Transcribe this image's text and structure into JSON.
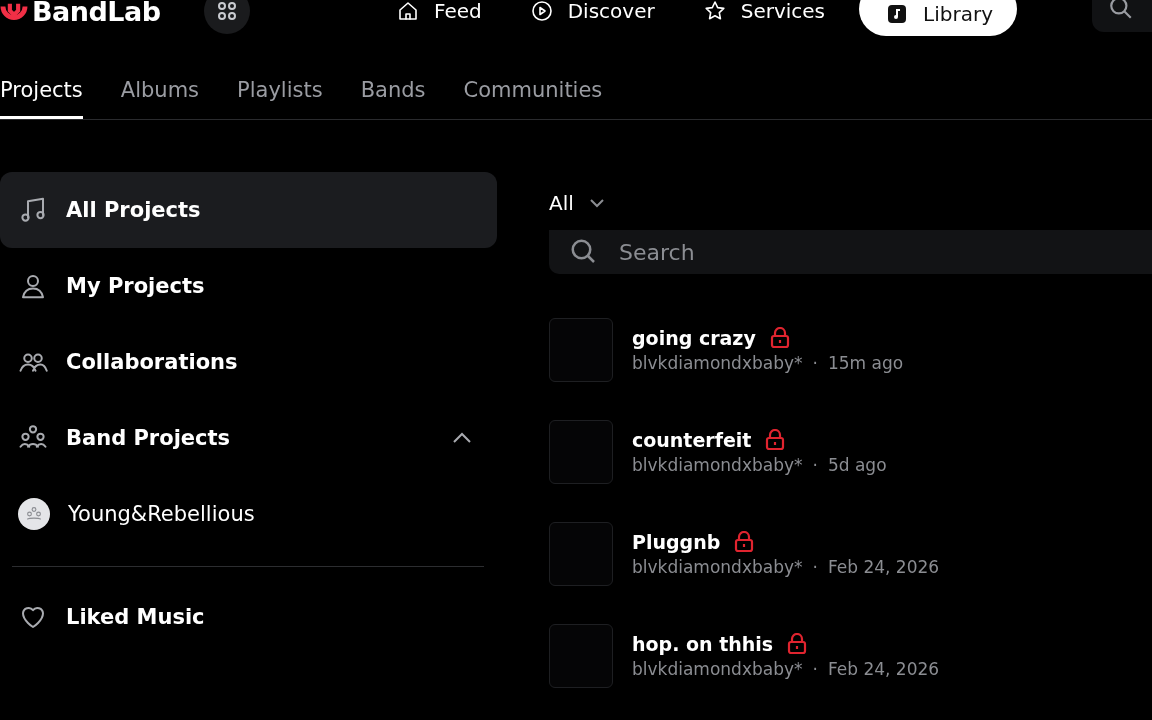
{
  "header": {
    "logo": "BandLab",
    "nav": [
      {
        "label": "Feed",
        "selected": false
      },
      {
        "label": "Discover",
        "selected": false
      },
      {
        "label": "Services",
        "selected": false
      },
      {
        "label": "Library",
        "selected": true
      }
    ]
  },
  "tabs": [
    {
      "label": "Projects",
      "selected": true
    },
    {
      "label": "Albums",
      "selected": false
    },
    {
      "label": "Playlists",
      "selected": false
    },
    {
      "label": "Bands",
      "selected": false
    },
    {
      "label": "Communities",
      "selected": false
    }
  ],
  "sidebar": {
    "items": [
      {
        "label": "All Projects",
        "selected": true
      },
      {
        "label": "My Projects",
        "selected": false
      },
      {
        "label": "Collaborations",
        "selected": false
      },
      {
        "label": "Band Projects",
        "selected": false,
        "expanded": true,
        "children": [
          {
            "label": "Young&Rebellious",
            "selected": false
          }
        ]
      },
      {
        "label": "Liked Music",
        "selected": false
      }
    ]
  },
  "filter": {
    "label": "All"
  },
  "search": {
    "placeholder": "Search"
  },
  "projects": [
    {
      "title": "going crazy",
      "locked": true,
      "author": "blvkdiamondxbaby*",
      "separator": "·",
      "time": "15m ago"
    },
    {
      "title": "counterfeit",
      "locked": true,
      "author": "blvkdiamondxbaby*",
      "separator": "·",
      "time": "5d ago"
    },
    {
      "title": "Pluggnb",
      "locked": true,
      "author": "blvkdiamondxbaby*",
      "separator": "·",
      "time": "Feb 24, 2026"
    },
    {
      "title": "hop. on thhis",
      "locked": true,
      "author": "blvkdiamondxbaby*",
      "separator": "·",
      "time": "Feb 24, 2026"
    }
  ]
}
